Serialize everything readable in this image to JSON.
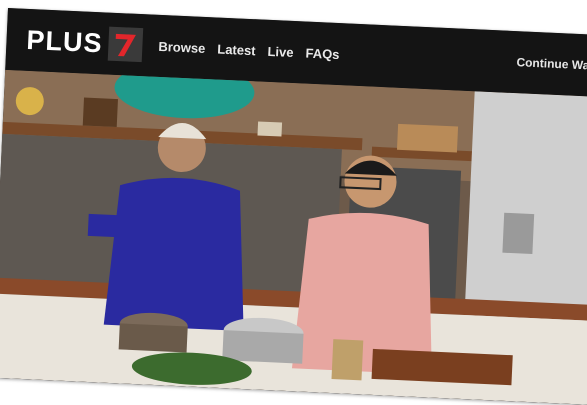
{
  "header": {
    "logo_text": "PLUS",
    "logo_badge_color": "#e3262b",
    "nav": [
      {
        "label": "Browse"
      },
      {
        "label": "Latest"
      },
      {
        "label": "Live"
      },
      {
        "label": "FAQs"
      }
    ],
    "continue_label": "Continue Watc"
  },
  "hero": {
    "icon": "video-still-cooking-show"
  }
}
